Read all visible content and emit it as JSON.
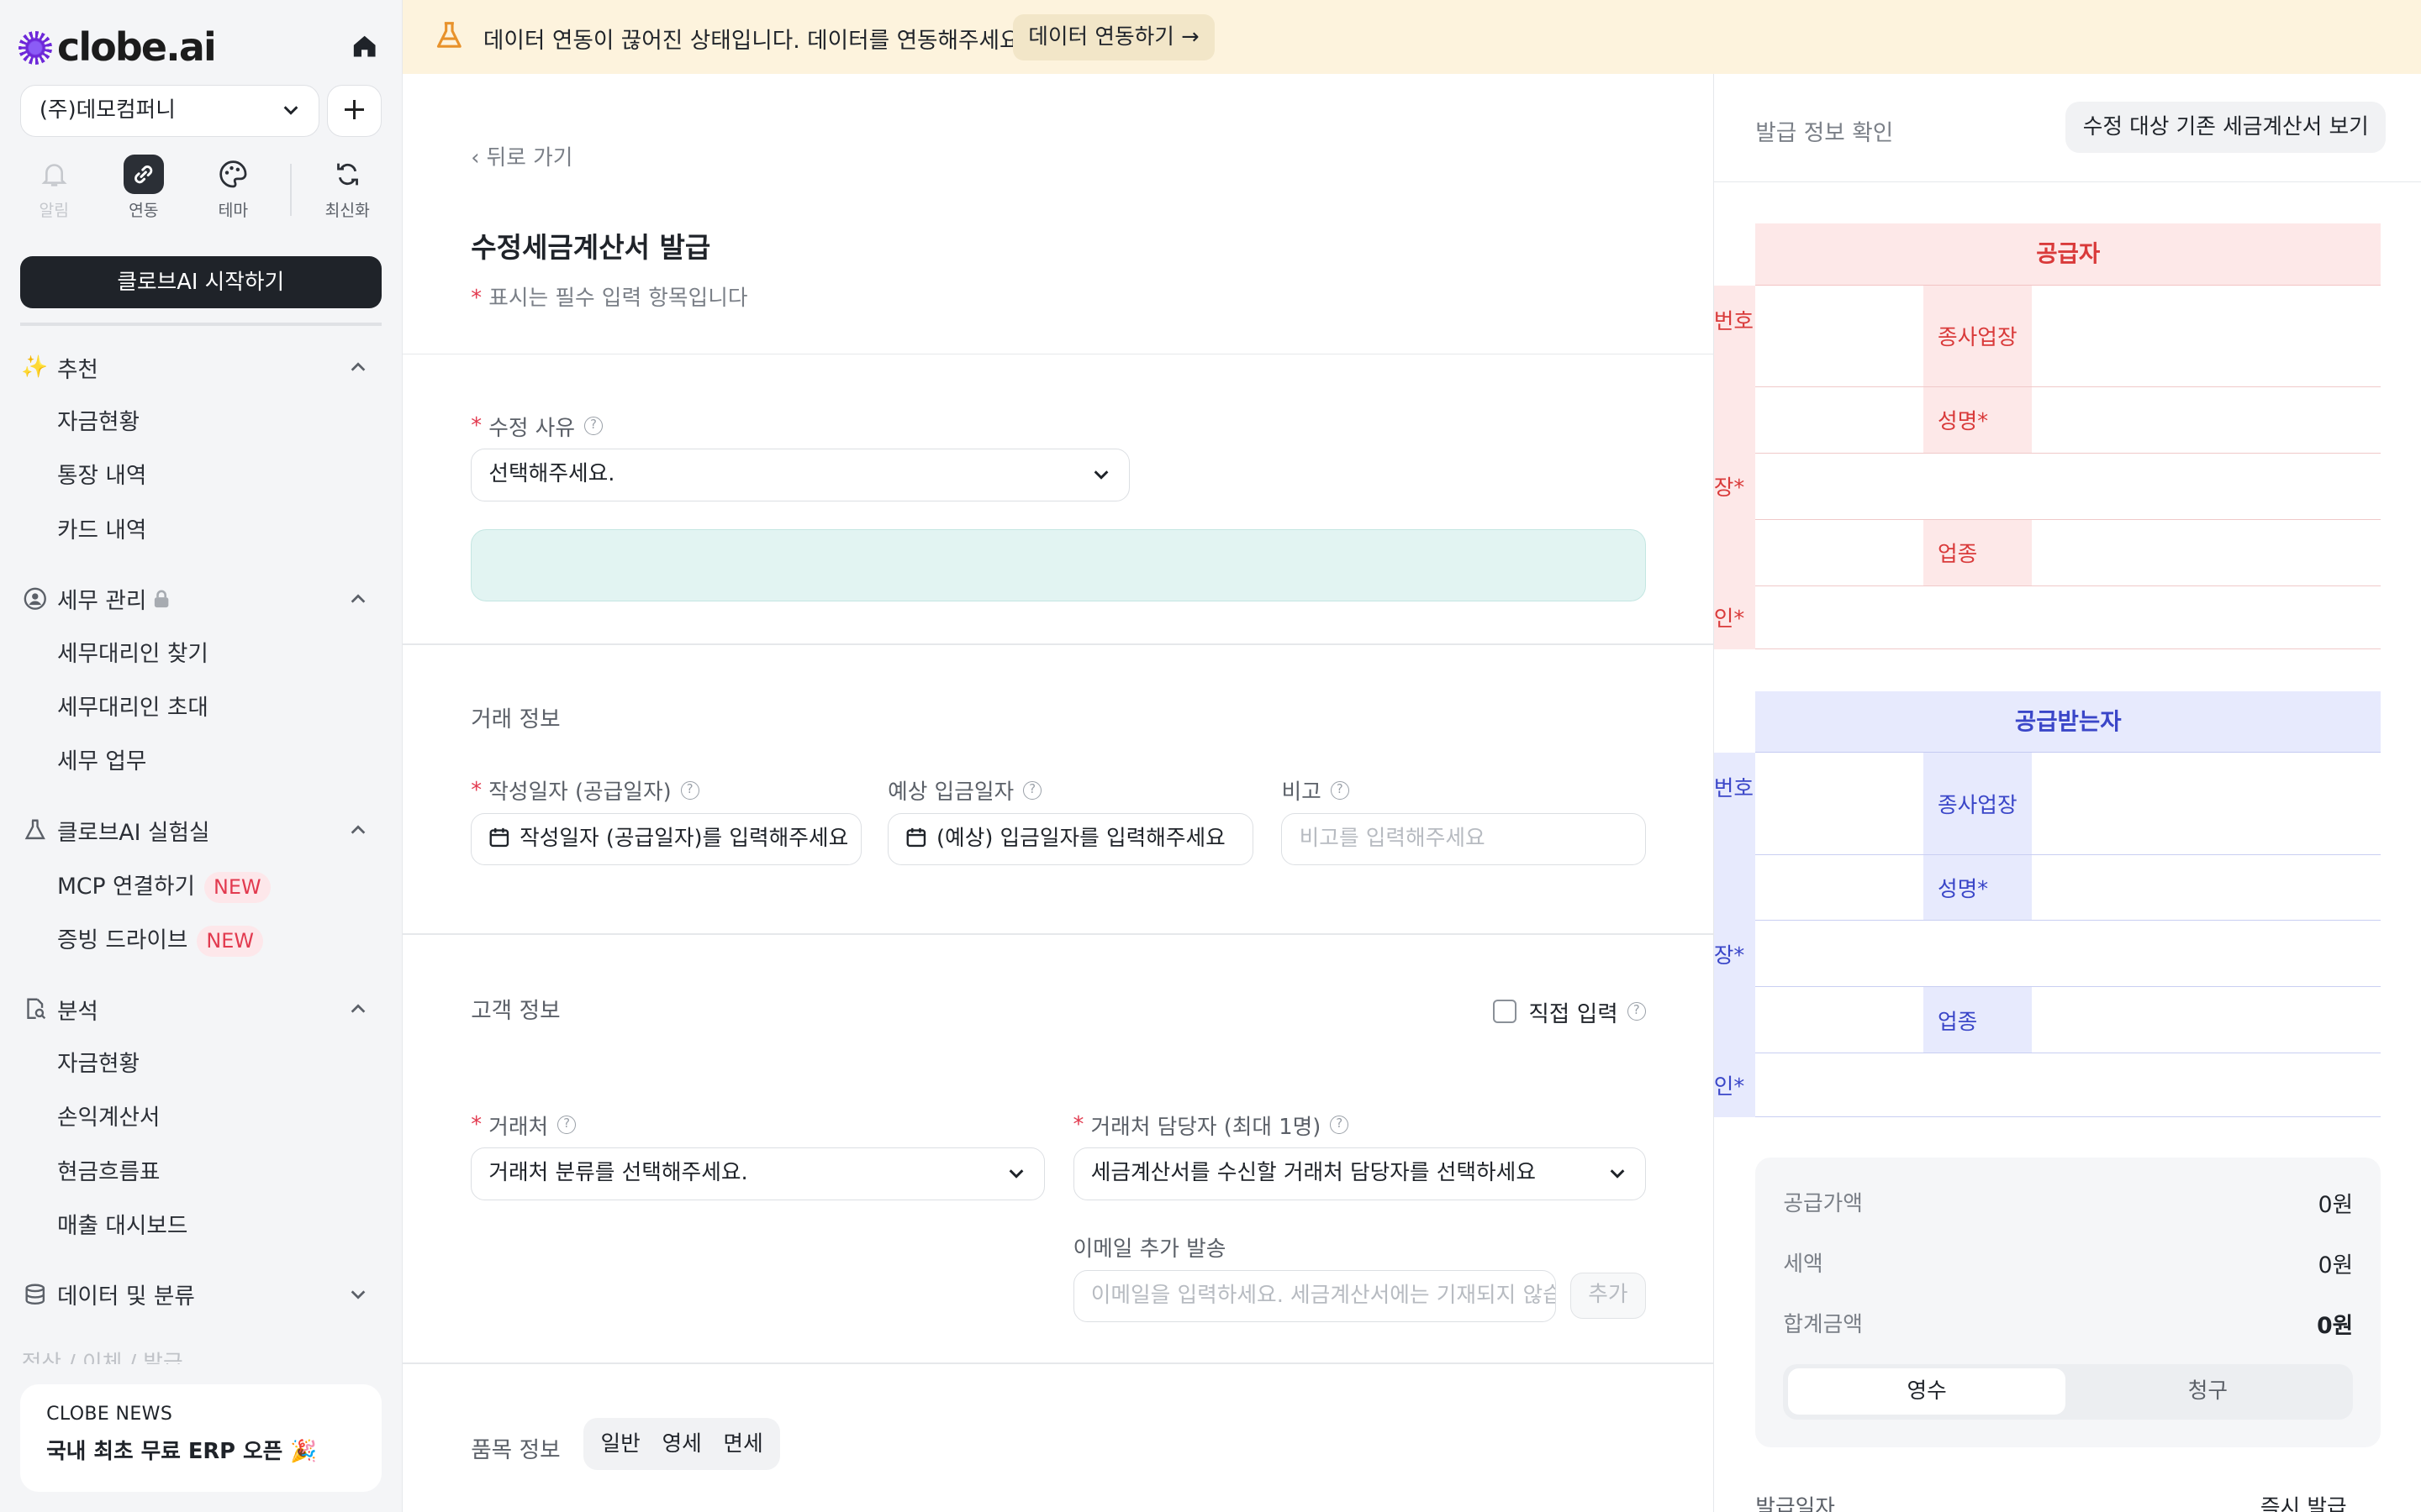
{
  "brand": {
    "name": "clobe.ai",
    "accent": "#6d28d9"
  },
  "sidebar": {
    "company": "(주)데모컴퍼니",
    "add_label": "+",
    "quick": [
      {
        "label": "알림",
        "icon": "bell-icon"
      },
      {
        "label": "연동",
        "icon": "link-icon"
      },
      {
        "label": "테마",
        "icon": "palette-icon"
      },
      {
        "label": "최신화",
        "icon": "refresh-icon"
      }
    ],
    "start_button": "클로브AI 시작하기",
    "sections": [
      {
        "title": "추천",
        "icon": "sparkle-icon",
        "items": [
          "자금현황",
          "통장 내역",
          "카드 내역"
        ]
      },
      {
        "title": "세무 관리",
        "icon": "user-shield-icon",
        "items": [
          "세무대리인 찾기",
          "세무대리인 초대",
          "세무 업무"
        ]
      },
      {
        "title": "클로브AI 실험실",
        "icon": "flask-icon",
        "items": [
          "MCP 연결하기",
          "증빙 드라이브"
        ],
        "badge": "NEW"
      },
      {
        "title": "분석",
        "icon": "doc-search-icon",
        "items": [
          "자금현황",
          "손익계산서",
          "현금흐름표",
          "매출 대시보드"
        ]
      },
      {
        "title": "데이터 및 분류",
        "icon": "database-icon",
        "items": []
      }
    ],
    "faded_item": "정산 / 이체 / 발급",
    "news": {
      "label": "CLOBE NEWS",
      "headline": "국내 최초 무료 ERP 오픈 🎉"
    }
  },
  "banner": {
    "message": "데이터 연동이 끊어진 상태입니다. 데이터를 연동해주세요.",
    "link_label": "데이터 연동하기 →",
    "bg": "#fdf3dd"
  },
  "form": {
    "back": "‹  뒤로 가기",
    "title": "수정세금계산서 발급",
    "required_note": " 표시는 필수 입력 항목입니다",
    "reason": {
      "label": "수정 사유",
      "value": "선택해주세요."
    },
    "deal_section": "거래 정보",
    "write_date": {
      "label": "작성일자 (공급일자)",
      "value": "작성일자 (공급일자)를 입력해주세요"
    },
    "expect_date": {
      "label": "예상 입금일자",
      "value": "(예상) 입금일자를 입력해주세요"
    },
    "memo": {
      "label": "비고",
      "placeholder": "비고를 입력해주세요"
    },
    "customer_section": "고객 정보",
    "direct_input": "직접 입력",
    "partner": {
      "label": "거래처",
      "value": "거래처 분류를 선택해주세요."
    },
    "manager": {
      "label": "거래처 담당자 (최대 1명)",
      "value": "세금계산서를 수신할 거래처 담당자를 선택하세요"
    },
    "email": {
      "label": "이메일 추가 발송",
      "placeholder": "이메일을 입력하세요. 세금계산서에는 기재되지 않습니다",
      "add": "추가"
    },
    "items_section": "품목 정보",
    "item_types": [
      "일반",
      "영세",
      "면세"
    ]
  },
  "preview": {
    "title": "발급 정보 확인",
    "view_original": "수정 대상 기존 세금계산서 보기",
    "supplier": {
      "header": "공급자",
      "cut_labels": [
        "번호",
        "장*",
        "인*"
      ],
      "cells": [
        "종사업장",
        "성명*",
        "업종"
      ],
      "color": "#d93a3a"
    },
    "receiver": {
      "header": "공급받는자",
      "cut_labels": [
        "번호",
        "장*",
        "인*"
      ],
      "cells": [
        "종사업장",
        "성명*",
        "업종"
      ],
      "color": "#3a46c8"
    },
    "summary": {
      "supply_label": "공급가액",
      "supply_value": "0원",
      "tax_label": "세액",
      "tax_value": "0원",
      "total_label": "합계금액",
      "total_value": "0원"
    },
    "receipt_toggle": [
      "영수",
      "청구"
    ],
    "issue_date_label": "발급일자",
    "instant_issue": "즉시 발급"
  }
}
